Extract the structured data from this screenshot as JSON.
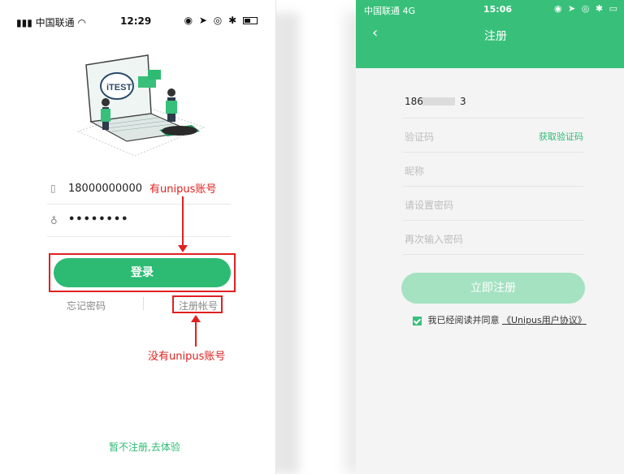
{
  "left": {
    "status": {
      "carrier": "中国联通",
      "time": "12:29"
    },
    "phone_value": "18000000000",
    "password_mask": "••••••••",
    "login_label": "登录",
    "forgot_label": "忘记密码",
    "register_label": "注册帐号",
    "guest_label": "暂不注册,去体验",
    "annotation_has_account": "有unipus账号",
    "annotation_no_account": "没有unipus账号"
  },
  "right": {
    "status": {
      "carrier": "中国联通 4G",
      "time": "15:06"
    },
    "back_icon": "‹",
    "title": "注册",
    "phone_prefix": "186",
    "phone_suffix": "3",
    "code_placeholder": "验证码",
    "get_code_label": "获取验证码",
    "nickname_placeholder": "昵称",
    "password_placeholder": "请设置密码",
    "password_confirm_placeholder": "再次输入密码",
    "register_button": "立即注册",
    "agree_prefix": "我已经阅读并同意",
    "agree_link": "《Unipus用户协议》"
  },
  "colors": {
    "brand_green": "#2dbb73",
    "header_green": "#38c07a",
    "annotation_red": "#e02020"
  }
}
